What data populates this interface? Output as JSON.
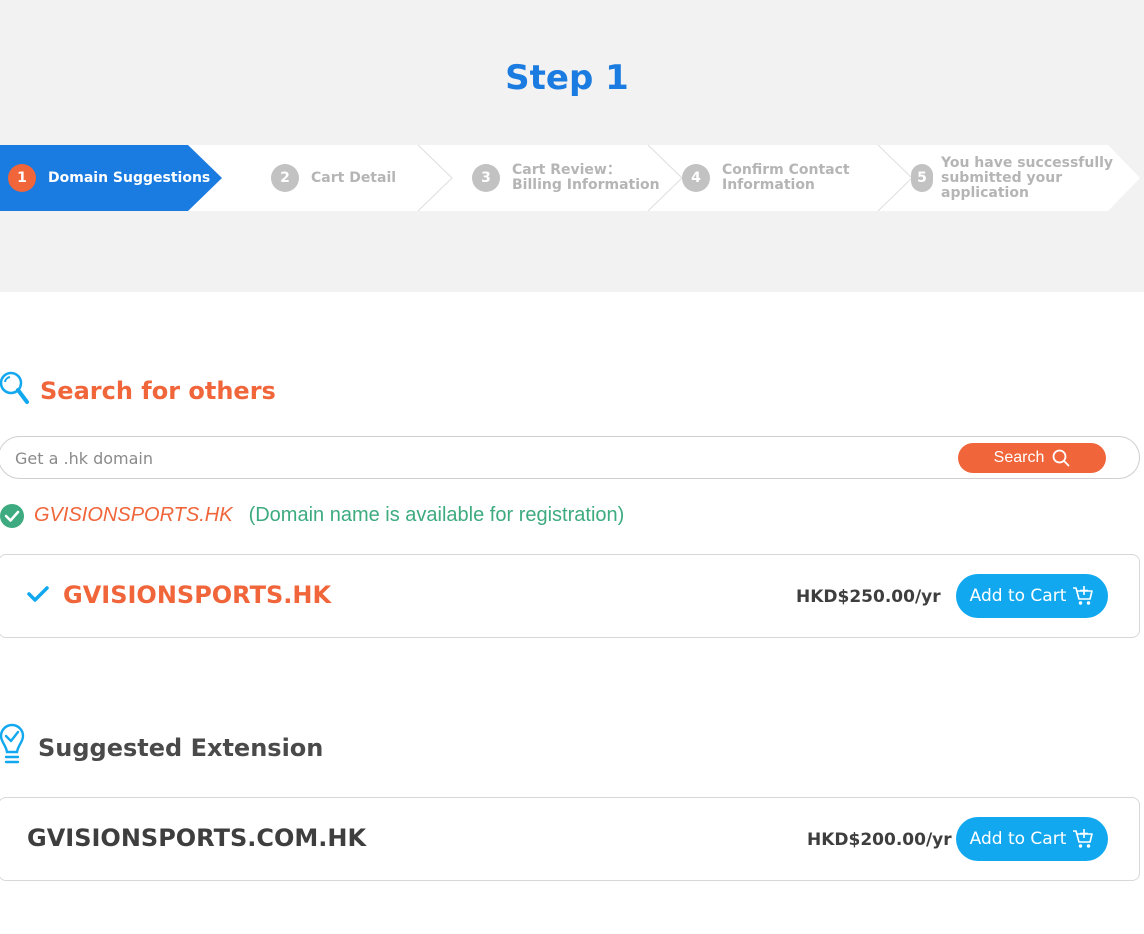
{
  "page": {
    "title": "Step 1"
  },
  "stepper": {
    "steps": [
      {
        "num": "1",
        "label": "Domain Suggestions"
      },
      {
        "num": "2",
        "label": "Cart Detail"
      },
      {
        "num": "3",
        "label": "Cart Review：\nBilling Information"
      },
      {
        "num": "4",
        "label": "Confirm Contact\nInformation"
      },
      {
        "num": "5",
        "label": "You have successfully\nsubmitted your\napplication"
      }
    ],
    "active_index": 0
  },
  "search_section": {
    "title": "Search for others",
    "placeholder": "Get a .hk domain",
    "value": "",
    "button_label": "Search"
  },
  "availability": {
    "domain": "GVISIONSPORTS.HK",
    "message": "(Domain name is available for registration)"
  },
  "result": {
    "domain": "GVISIONSPORTS.HK",
    "price": "HKD$250.00/yr",
    "button_label": "Add to Cart"
  },
  "suggested_section": {
    "title": "Suggested Extension",
    "items": [
      {
        "domain": "GVISIONSPORTS.COM.HK",
        "price": "HKD$200.00/yr",
        "button_label": "Add to Cart"
      }
    ]
  },
  "icons": {
    "search_section": "magnifier-icon",
    "suggested_section": "lightbulb-check-icon",
    "availability": "check-circle-icon",
    "result": "checkmark-icon",
    "search_button": "search-icon",
    "cart": "cart-icon"
  },
  "colors": {
    "primary_blue": "#1a7be0",
    "accent_orange": "#f0653a",
    "cart_blue": "#12a8ef",
    "success_green": "#3dab7f",
    "header_bg": "#f2f2f2"
  }
}
